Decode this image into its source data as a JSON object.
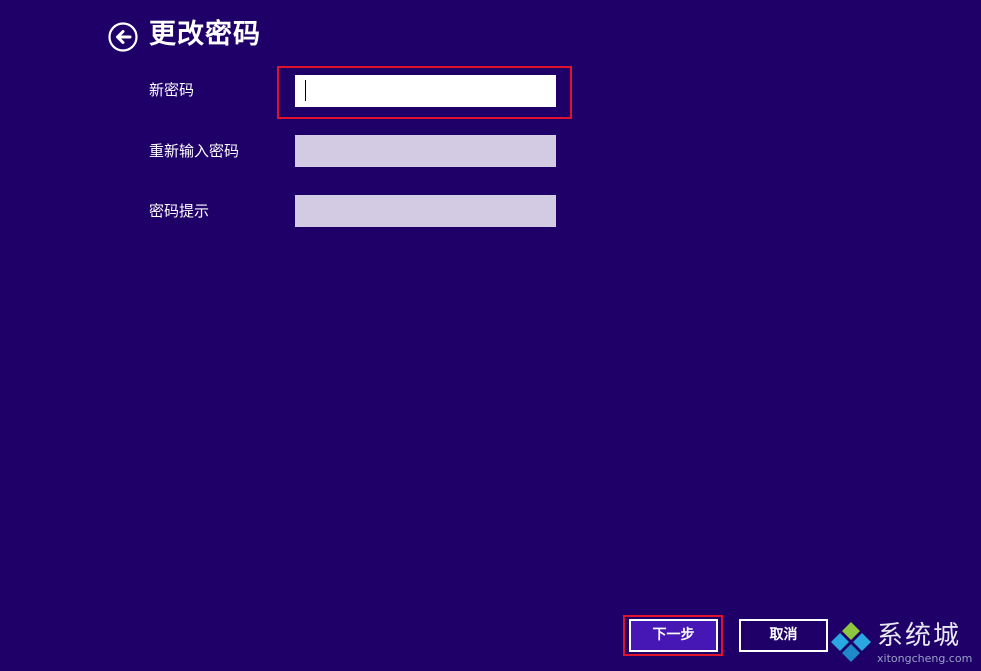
{
  "header": {
    "back_icon": "back-arrow-circle-icon",
    "title": "更改密码"
  },
  "form": {
    "new_password": {
      "label": "新密码",
      "value": "",
      "state": "focused"
    },
    "confirm_password": {
      "label": "重新输入密码",
      "value": "",
      "state": "disabled"
    },
    "password_hint": {
      "label": "密码提示",
      "value": "",
      "state": "disabled"
    }
  },
  "buttons": {
    "next_label": "下一步",
    "cancel_label": "取消"
  },
  "watermark": {
    "name": "系统城",
    "url": "xitongcheng.com",
    "icon": "diamond-logo-icon"
  },
  "colors": {
    "background": "#1f0068",
    "input_active": "#ffffff",
    "input_disabled": "#d3cae3",
    "next_button": "#4617b4",
    "highlight_border": "#e0132c",
    "text": "#ffffff"
  }
}
